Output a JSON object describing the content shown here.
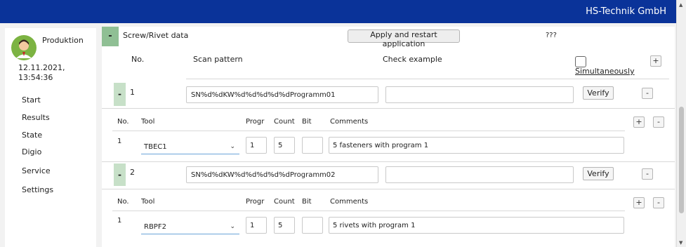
{
  "header": {
    "brand": "HS-Technik GmbH"
  },
  "sidebar": {
    "user": "Produktion",
    "date": "12.11.2021,",
    "time": "13:54:36",
    "items": [
      "Start",
      "Results",
      "State",
      "Digio",
      "Service",
      "Settings"
    ]
  },
  "section": {
    "toggle": "-",
    "title": "Screw/Rivet data",
    "apply_label": "Apply and restart application",
    "qmark": "???",
    "col_no": "No.",
    "col_scan": "Scan pattern",
    "col_check": "Check example",
    "simultaneously": "Simultaneously",
    "add": "+"
  },
  "rows": [
    {
      "toggle": "-",
      "no": "1",
      "scan_pattern": "SN%d%dKW%d%d%d%d%dProgramm01",
      "check_example": "",
      "verify": "Verify",
      "remove": "-",
      "sub": {
        "h_no": "No.",
        "h_tool": "Tool",
        "h_progr": "Progr",
        "h_count": "Count",
        "h_bit": "Bit",
        "h_comments": "Comments",
        "add": "+",
        "remove": "-",
        "item": {
          "no": "1",
          "tool": "TBEC1",
          "progr": "1",
          "count": "5",
          "bit": "",
          "comments": "5 fasteners with program 1"
        }
      }
    },
    {
      "toggle": "-",
      "no": "2",
      "scan_pattern": "SN%d%dKW%d%d%d%d%dProgramm02",
      "check_example": "",
      "verify": "Verify",
      "remove": "-",
      "sub": {
        "h_no": "No.",
        "h_tool": "Tool",
        "h_progr": "Progr",
        "h_count": "Count",
        "h_bit": "Bit",
        "h_comments": "Comments",
        "add": "+",
        "remove": "-",
        "item": {
          "no": "1",
          "tool": "RBPF2",
          "progr": "1",
          "count": "5",
          "bit": "",
          "comments": "5 rivets with program 1"
        }
      }
    }
  ],
  "colors": {
    "topbar": "#0a3399",
    "toggle_green": "#8fbf94",
    "row_toggle": "#c7e0c8",
    "select_underline": "#6aa4d8"
  }
}
